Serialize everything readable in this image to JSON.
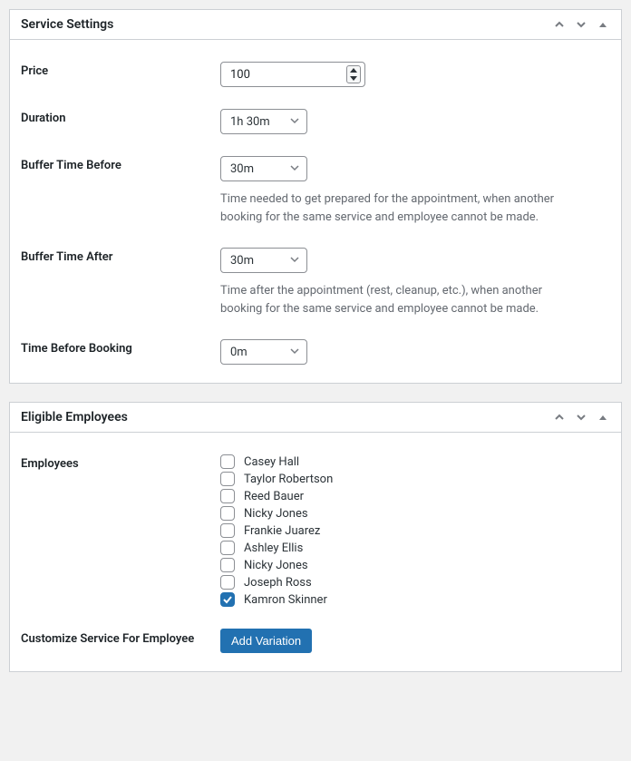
{
  "panels": {
    "service": {
      "title": "Service Settings",
      "price": {
        "label": "Price",
        "value": "100"
      },
      "duration": {
        "label": "Duration",
        "value": "1h 30m"
      },
      "buffer_before": {
        "label": "Buffer Time Before",
        "value": "30m",
        "help": "Time needed to get prepared for the appointment, when another booking for the same service and employee cannot be made."
      },
      "buffer_after": {
        "label": "Buffer Time After",
        "value": "30m",
        "help": "Time after the appointment (rest, cleanup, etc.), when another booking for the same service and employee cannot be made."
      },
      "time_before_booking": {
        "label": "Time Before Booking",
        "value": "0m"
      }
    },
    "employees": {
      "title": "Eligible Employees",
      "employees_label": "Employees",
      "list": [
        {
          "name": "Casey Hall",
          "checked": false
        },
        {
          "name": "Taylor Robertson",
          "checked": false
        },
        {
          "name": "Reed Bauer",
          "checked": false
        },
        {
          "name": "Nicky Jones",
          "checked": false
        },
        {
          "name": "Frankie Juarez",
          "checked": false
        },
        {
          "name": "Ashley Ellis",
          "checked": false
        },
        {
          "name": "Nicky Jones",
          "checked": false
        },
        {
          "name": "Joseph Ross",
          "checked": false
        },
        {
          "name": "Kamron Skinner",
          "checked": true
        }
      ],
      "customize": {
        "label": "Customize Service For Employee",
        "button": "Add Variation"
      }
    }
  }
}
